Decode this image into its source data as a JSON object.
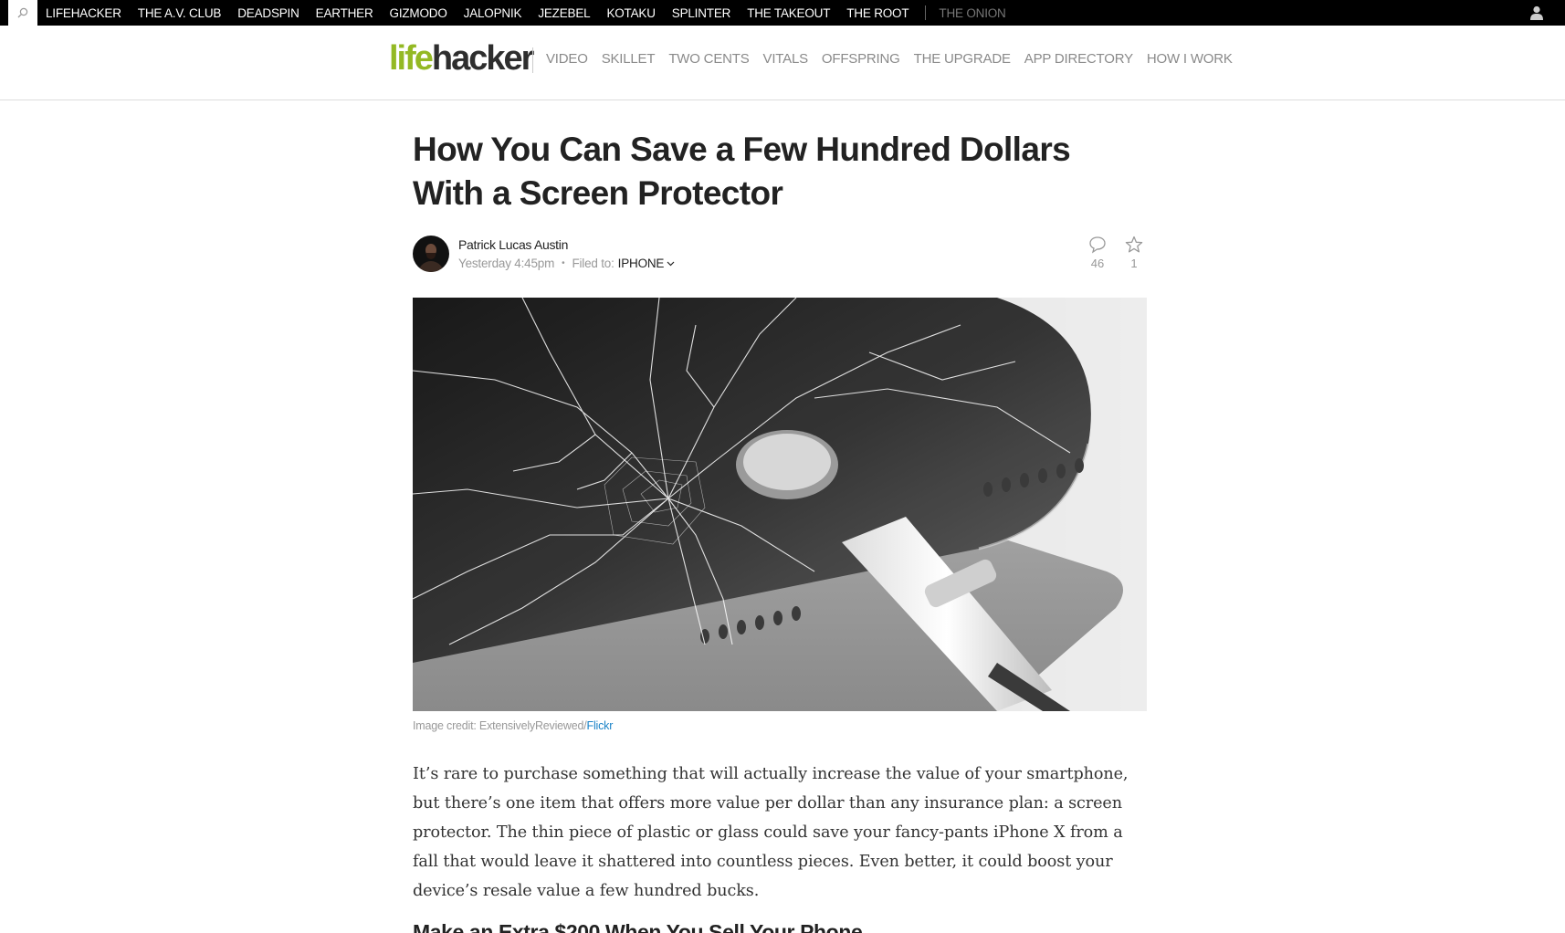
{
  "network_bar": {
    "sites": [
      "LIFEHACKER",
      "THE A.V. CLUB",
      "DEADSPIN",
      "EARTHER",
      "GIZMODO",
      "JALOPNIK",
      "JEZEBEL",
      "KOTAKU",
      "SPLINTER",
      "THE TAKEOUT",
      "THE ROOT"
    ],
    "partner_site": "THE ONION"
  },
  "header": {
    "logo_part1": "life",
    "logo_part2": "hacker",
    "sections": [
      "VIDEO",
      "SKILLET",
      "TWO CENTS",
      "VITALS",
      "OFFSPRING",
      "THE UPGRADE",
      "APP DIRECTORY",
      "HOW I WORK"
    ]
  },
  "article": {
    "headline": "How You Can Save a Few Hundred Dollars With a Screen Protector",
    "author": "Patrick Lucas Austin",
    "timestamp": "Yesterday 4:45pm",
    "filed_to_label": "Filed to:",
    "tag": "IPHONE",
    "comment_count": "46",
    "like_count": "1",
    "image_credit_prefix": "Image credit: ExtensivelyReviewed/",
    "image_credit_link": "Flickr",
    "paragraph": "It’s rare to purchase something that will actually increase the value of your smartphone, but there’s one item that offers more value per dollar than any insurance plan: a screen protector. The thin piece of plastic or glass could save your fancy-pants iPhone X from a fall that would leave it shattered into countless pieces. Even better, it could boost your device’s resale value a few hundred bucks.",
    "subheading": "Make an Extra $200 When You Sell Your Phone"
  }
}
